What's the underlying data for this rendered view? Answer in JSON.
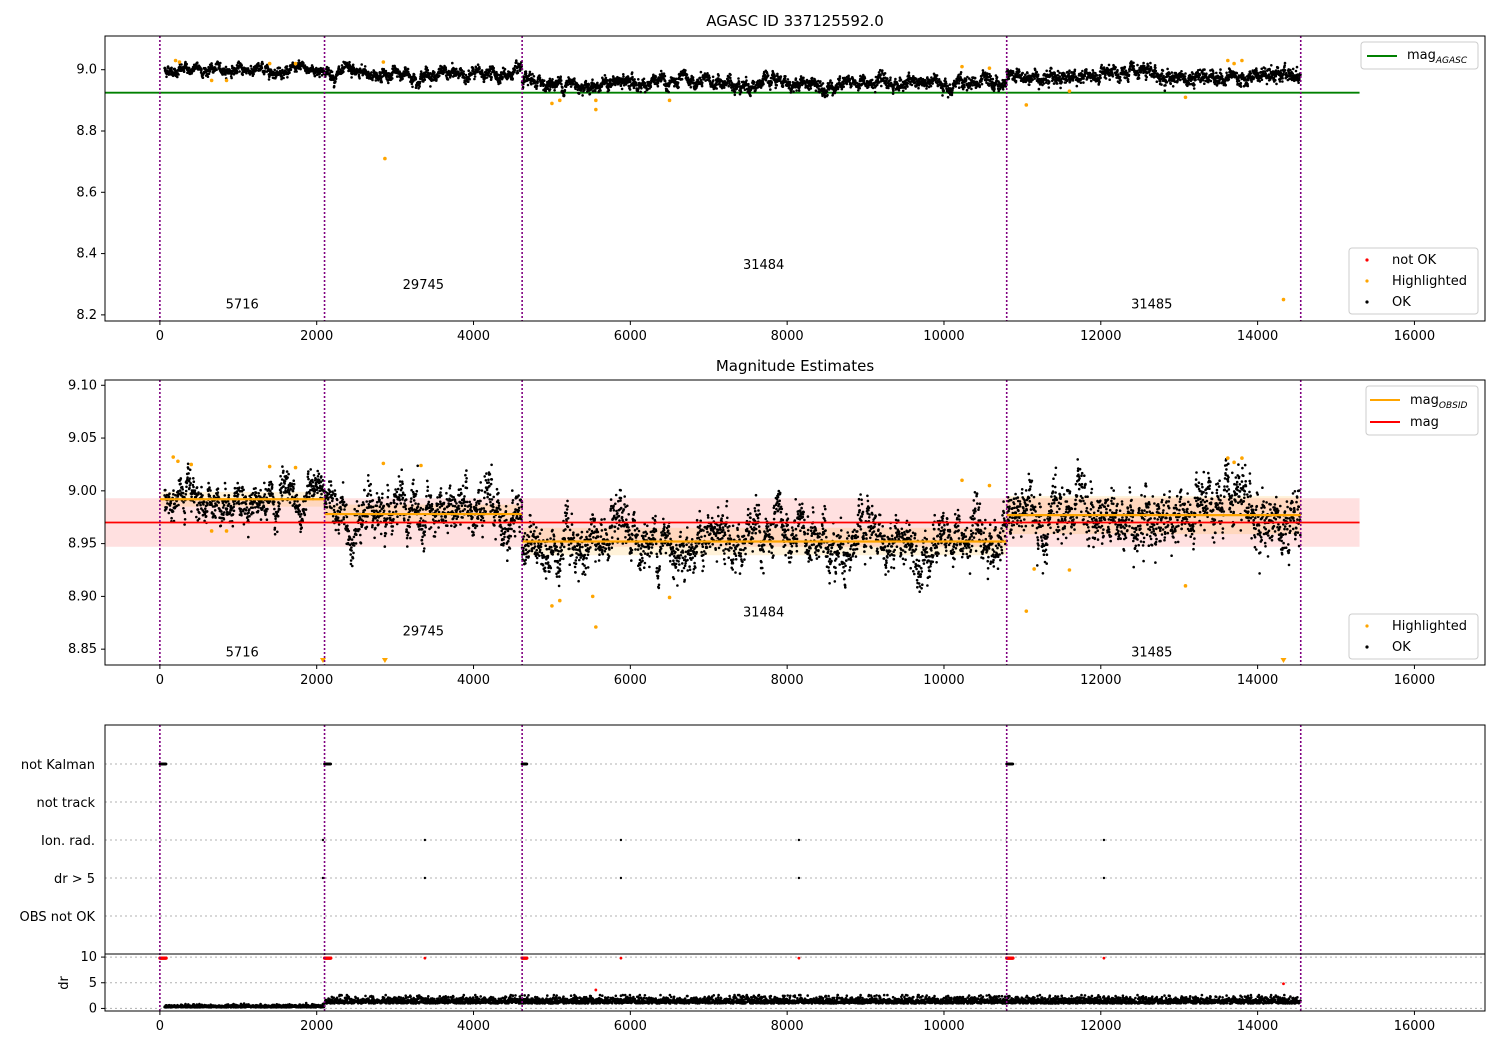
{
  "chart_data": [
    {
      "type": "scatter",
      "title": "AGASC ID 337125592.0",
      "xlim": [
        -700,
        16900
      ],
      "ylim": [
        8.18,
        9.11
      ],
      "xticks": [
        0,
        2000,
        4000,
        6000,
        8000,
        10000,
        12000,
        14000,
        16000
      ],
      "yticks": [
        8.2,
        8.4,
        8.6,
        8.8,
        9.0
      ],
      "segments": [
        {
          "start": 0,
          "end": 2100,
          "level": 9.0,
          "noise": 0.01
        },
        {
          "start": 2100,
          "end": 4620,
          "level": 8.985,
          "noise": 0.012
        },
        {
          "start": 4620,
          "end": 10800,
          "level": 8.955,
          "noise": 0.013
        },
        {
          "start": 10800,
          "end": 14550,
          "level": 8.98,
          "noise": 0.014
        }
      ],
      "ok_x_range": [
        60,
        14550
      ],
      "obs_boundaries": [
        0,
        2100,
        4620,
        10800,
        14550
      ],
      "obs_labels": [
        {
          "x": 1050,
          "y": 8.22,
          "text": "5716"
        },
        {
          "x": 3360,
          "y": 8.285,
          "text": "29745"
        },
        {
          "x": 7700,
          "y": 8.35,
          "text": "31484"
        },
        {
          "x": 12650,
          "y": 8.22,
          "text": "31485"
        }
      ],
      "mag_agasc": 8.925,
      "mag_agasc_xrange": [
        -700,
        15300
      ],
      "highlighted_points": [
        [
          200,
          9.03
        ],
        [
          250,
          9.025
        ],
        [
          660,
          8.965
        ],
        [
          850,
          8.965
        ],
        [
          1400,
          9.02
        ],
        [
          1730,
          9.02
        ],
        [
          2850,
          9.025
        ],
        [
          2870,
          8.71
        ],
        [
          5000,
          8.89
        ],
        [
          5100,
          8.9
        ],
        [
          5560,
          8.87
        ],
        [
          5560,
          8.9
        ],
        [
          6500,
          8.9
        ],
        [
          10230,
          9.01
        ],
        [
          10580,
          9.005
        ],
        [
          11050,
          8.885
        ],
        [
          11600,
          8.93
        ],
        [
          13080,
          8.91
        ],
        [
          13620,
          9.03
        ],
        [
          13700,
          9.02
        ],
        [
          13800,
          9.03
        ],
        [
          14330,
          8.25
        ]
      ],
      "legend_top": [
        {
          "label": "mag",
          "sub": "AGASC",
          "color": "#008000"
        }
      ],
      "legend_bottom": [
        {
          "label": "not OK",
          "color": "#ff0000"
        },
        {
          "label": "Highlighted",
          "color": "#ffa500"
        },
        {
          "label": "OK",
          "color": "#000000"
        }
      ]
    },
    {
      "type": "scatter",
      "title": "Magnitude Estimates",
      "xlim": [
        -700,
        16900
      ],
      "ylim": [
        8.835,
        9.105
      ],
      "xticks": [
        0,
        2000,
        4000,
        6000,
        8000,
        10000,
        12000,
        14000,
        16000
      ],
      "yticks": [
        8.85,
        8.9,
        8.95,
        9.0,
        9.05,
        9.1
      ],
      "segments": [
        {
          "start": 0,
          "end": 2100,
          "level": 8.992,
          "noise": 0.01
        },
        {
          "start": 2100,
          "end": 4620,
          "level": 8.978,
          "noise": 0.013
        },
        {
          "start": 4620,
          "end": 10800,
          "level": 8.952,
          "noise": 0.014
        },
        {
          "start": 10800,
          "end": 14550,
          "level": 8.977,
          "noise": 0.016
        }
      ],
      "obs_boundaries": [
        0,
        2100,
        4620,
        10800,
        14550
      ],
      "obs_labels": [
        {
          "x": 1050,
          "y": 8.843,
          "text": "5716"
        },
        {
          "x": 3360,
          "y": 8.863,
          "text": "29745"
        },
        {
          "x": 7700,
          "y": 8.881,
          "text": "31484"
        },
        {
          "x": 12650,
          "y": 8.843,
          "text": "31485"
        }
      ],
      "mag_obsid": [
        {
          "start": 0,
          "end": 2100,
          "value": 8.992,
          "band": 0.007
        },
        {
          "start": 2100,
          "end": 4620,
          "value": 8.978,
          "band": 0.009
        },
        {
          "start": 4620,
          "end": 10800,
          "value": 8.952,
          "band": 0.013
        },
        {
          "start": 10800,
          "end": 14550,
          "value": 8.977,
          "band": 0.018
        }
      ],
      "mag": 8.97,
      "mag_band": [
        8.947,
        8.993
      ],
      "mag_xrange": [
        -700,
        15300
      ],
      "highlighted_points": [
        [
          170,
          9.032
        ],
        [
          230,
          9.028
        ],
        [
          400,
          9.025
        ],
        [
          660,
          8.962
        ],
        [
          850,
          8.962
        ],
        [
          1400,
          9.023
        ],
        [
          1730,
          9.022
        ],
        [
          2850,
          9.026
        ],
        [
          3330,
          9.024
        ],
        [
          5000,
          8.891
        ],
        [
          5100,
          8.896
        ],
        [
          5520,
          8.9
        ],
        [
          5560,
          8.871
        ],
        [
          6500,
          8.899
        ],
        [
          10230,
          9.01
        ],
        [
          10580,
          9.005
        ],
        [
          11050,
          8.886
        ],
        [
          11150,
          8.926
        ],
        [
          11600,
          8.925
        ],
        [
          13080,
          8.91
        ],
        [
          13620,
          9.031
        ],
        [
          13700,
          9.027
        ],
        [
          13800,
          9.031
        ]
      ],
      "downarrows": [
        2080,
        2870,
        14330
      ],
      "legend_top": [
        {
          "label": "mag",
          "sub": "OBSID",
          "color": "#ffa500"
        },
        {
          "label": "mag",
          "sub": "",
          "color": "#ff0000"
        }
      ],
      "legend_bottom": [
        {
          "label": "Highlighted",
          "color": "#ffa500"
        },
        {
          "label": "OK",
          "color": "#000000"
        }
      ]
    },
    {
      "type": "scatter",
      "xlim": [
        -700,
        16900
      ],
      "xticks": [
        0,
        2000,
        4000,
        6000,
        8000,
        10000,
        12000,
        14000,
        16000
      ],
      "flag_rows": [
        "not Kalman",
        "not track",
        "Ion. rad.",
        "dr > 5",
        "OBS not OK"
      ],
      "flag_points": {
        "not Kalman": [
          [
            0,
            80
          ],
          [
            2100,
            2180
          ],
          [
            4620,
            4680
          ],
          [
            10800,
            10880
          ]
        ],
        "Ion. rad.": [
          2080,
          3380,
          5880,
          8150,
          12040
        ],
        "dr > 5": [
          2080,
          3380,
          5880,
          8150,
          12040
        ]
      },
      "obs_boundaries": [
        0,
        2100,
        4620,
        10800,
        14550
      ],
      "dr": {
        "ylabel": "dr",
        "yticks": [
          0,
          5,
          10
        ],
        "ylim": [
          -0.5,
          10.6
        ],
        "segments": [
          {
            "start": 60,
            "end": 2100,
            "level": 0.3,
            "noise": 0.3
          },
          {
            "start": 2100,
            "end": 14550,
            "level": 1.2,
            "noise": 0.8
          }
        ],
        "red_clusters": [
          [
            0,
            80
          ],
          [
            2100,
            2180
          ],
          [
            4620,
            4680
          ],
          [
            10800,
            10880
          ]
        ],
        "red_single": [
          [
            3380,
            9.8
          ],
          [
            5880,
            9.8
          ],
          [
            8150,
            9.8
          ],
          [
            12040,
            9.8
          ],
          [
            5560,
            3.6
          ],
          [
            14330,
            4.8
          ]
        ]
      }
    }
  ]
}
